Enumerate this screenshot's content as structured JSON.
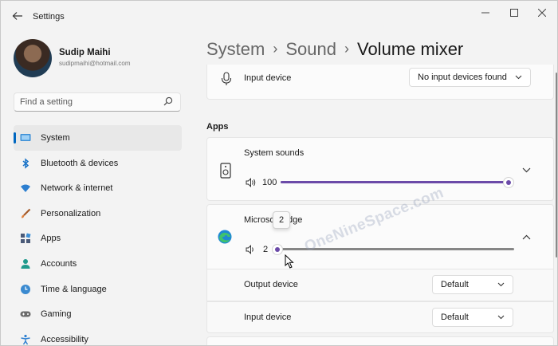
{
  "window": {
    "title": "Settings"
  },
  "user": {
    "name": "Sudip Maihi",
    "email": "sudipmaihi@hotmail.com"
  },
  "search": {
    "placeholder": "Find a setting"
  },
  "nav": [
    {
      "label": "System",
      "icon": "monitor-icon",
      "active": true
    },
    {
      "label": "Bluetooth & devices",
      "icon": "bluetooth-icon"
    },
    {
      "label": "Network & internet",
      "icon": "wifi-icon"
    },
    {
      "label": "Personalization",
      "icon": "brush-icon"
    },
    {
      "label": "Apps",
      "icon": "apps-icon"
    },
    {
      "label": "Accounts",
      "icon": "person-icon"
    },
    {
      "label": "Time & language",
      "icon": "clock-globe-icon"
    },
    {
      "label": "Gaming",
      "icon": "gamepad-icon"
    },
    {
      "label": "Accessibility",
      "icon": "accessibility-icon"
    }
  ],
  "breadcrumb": {
    "items": [
      "System",
      "Sound"
    ],
    "current": "Volume mixer"
  },
  "input_device_top": {
    "label": "Input device",
    "value": "No input devices found"
  },
  "apps_section": {
    "title": "Apps"
  },
  "system_sounds": {
    "label": "System sounds",
    "volume_text": "100",
    "volume": 100
  },
  "edge": {
    "label": "Microsoft Edge",
    "volume_text": "2",
    "volume": 2,
    "tooltip": "2"
  },
  "output_device": {
    "label": "Output device",
    "value": "Default"
  },
  "input_device": {
    "label": "Input device",
    "value": "Default"
  },
  "watermark": "OneNineSpace.com",
  "colors": {
    "accent": "#6b4aa8",
    "nav_indicator": "#0067c0",
    "window_bg": "#f3f3f3"
  }
}
